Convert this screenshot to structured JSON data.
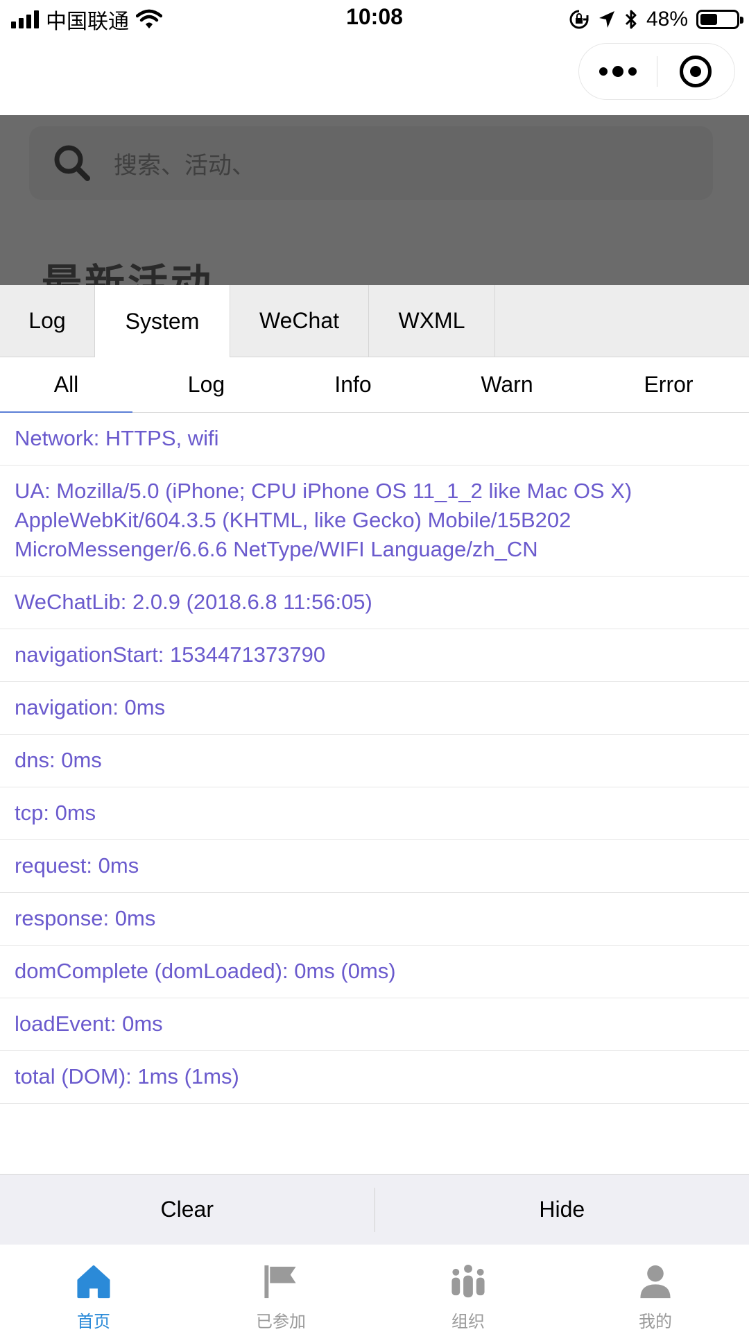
{
  "status_bar": {
    "carrier": "中国联通",
    "time": "10:08",
    "battery_percent": "48%",
    "battery_level": 0.48
  },
  "capsule": {
    "icons": [
      "more-dots-icon",
      "close-target-icon"
    ]
  },
  "page_behind": {
    "search_placeholder": "搜索、活动、",
    "section_title": "最新活动"
  },
  "vconsole": {
    "tabs": [
      {
        "label": "Log",
        "active": false
      },
      {
        "label": "System",
        "active": true
      },
      {
        "label": "WeChat",
        "active": false
      },
      {
        "label": "WXML",
        "active": false
      }
    ],
    "subtabs": [
      {
        "label": "All",
        "active": true
      },
      {
        "label": "Log",
        "active": false
      },
      {
        "label": "Info",
        "active": false
      },
      {
        "label": "Warn",
        "active": false
      },
      {
        "label": "Error",
        "active": false
      }
    ],
    "logs": [
      "Network: HTTPS, wifi",
      "UA: Mozilla/5.0 (iPhone; CPU iPhone OS 11_1_2 like Mac OS X) AppleWebKit/604.3.5 (KHTML, like Gecko) Mobile/15B202 MicroMessenger/6.6.6 NetType/WIFI Language/zh_CN",
      "WeChatLib: 2.0.9 (2018.6.8 11:56:05)",
      "navigationStart: 1534471373790",
      "navigation: 0ms",
      "dns: 0ms",
      "tcp: 0ms",
      "request: 0ms",
      "response: 0ms",
      "domComplete (domLoaded): 0ms (0ms)",
      "loadEvent: 0ms",
      "total (DOM): 1ms (1ms)"
    ],
    "toolbar": {
      "clear_label": "Clear",
      "hide_label": "Hide"
    }
  },
  "tab_bar": {
    "items": [
      {
        "label": "首页",
        "icon": "home-icon",
        "active": true
      },
      {
        "label": "已参加",
        "icon": "flag-icon",
        "active": false
      },
      {
        "label": "组织",
        "icon": "group-icon",
        "active": false
      },
      {
        "label": "我的",
        "icon": "user-icon",
        "active": false
      }
    ]
  },
  "colors": {
    "log_text": "#6a5acd",
    "accent": "#2b8ad8",
    "inactive": "#9a9a9a",
    "subtab_underline": "#5b7fd6"
  }
}
